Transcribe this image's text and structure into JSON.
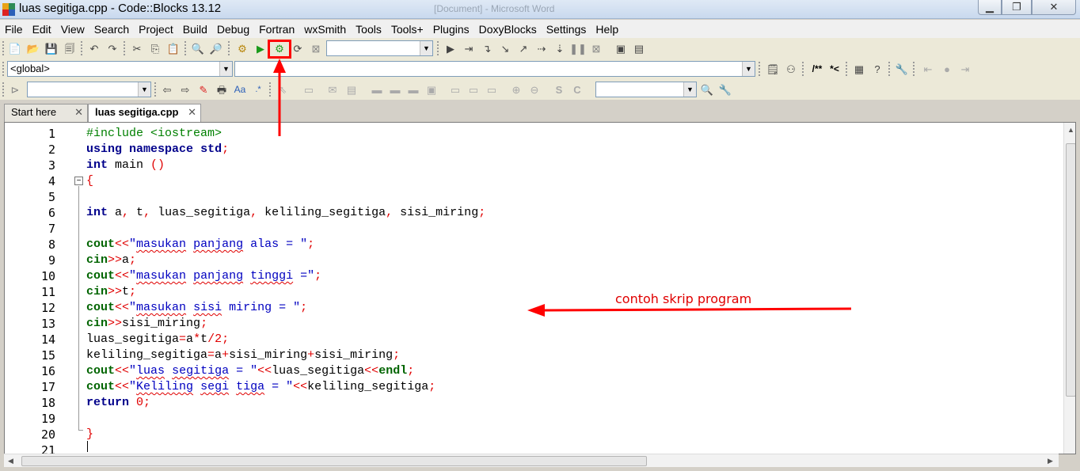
{
  "window": {
    "title": "luas segitiga.cpp - Code::Blocks 13.12",
    "background_window_title": "[Document] - Microsoft Word"
  },
  "menu": [
    "File",
    "Edit",
    "View",
    "Search",
    "Project",
    "Build",
    "Debug",
    "Fortran",
    "wxSmith",
    "Tools",
    "Tools+",
    "Plugins",
    "DoxyBlocks",
    "Settings",
    "Help"
  ],
  "toolbar": {
    "scope_combo": "<global>",
    "function_combo": "",
    "doxy_labels": [
      "/**",
      "*<"
    ],
    "search_combo": ""
  },
  "tabs": [
    {
      "label": "Start here",
      "close": "✕"
    },
    {
      "label": "luas segitiga.cpp",
      "close": "✕"
    }
  ],
  "editor": {
    "line_numbers": [
      "1",
      "2",
      "3",
      "4",
      "5",
      "6",
      "7",
      "8",
      "9",
      "10",
      "11",
      "12",
      "13",
      "14",
      "15",
      "16",
      "17",
      "18",
      "19",
      "20",
      "21"
    ]
  },
  "annotation": {
    "text": "contoh skrip program",
    "color": "#e00000"
  },
  "colors": {
    "keyword": "#00008b",
    "preprocessor": "#008000",
    "operator": "#e00000",
    "string": "#0000c0",
    "highlight": "#ff0000"
  }
}
